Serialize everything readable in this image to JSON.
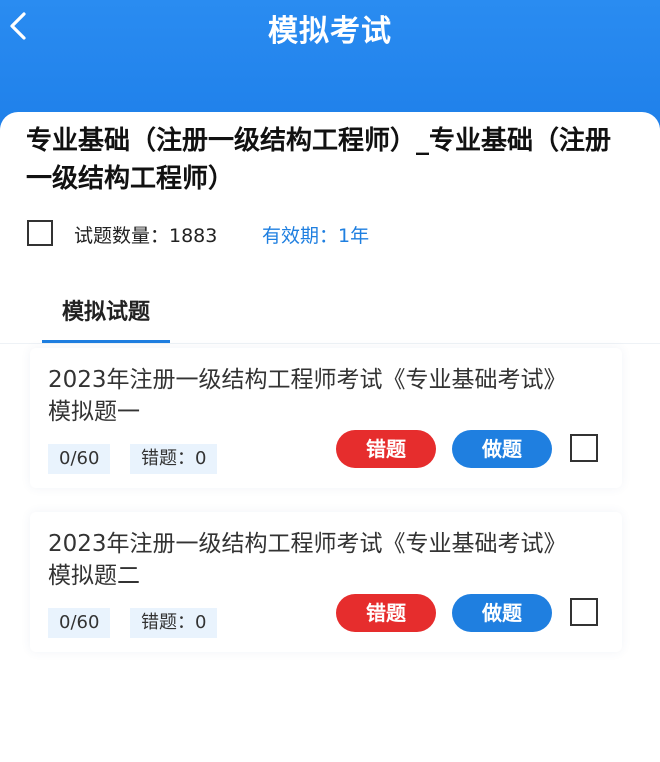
{
  "header": {
    "title": "模拟考试",
    "back_icon": "chevron-left-icon"
  },
  "course": {
    "title": "专业基础（注册一级结构工程师）_专业基础（注册一级结构工程师）",
    "count_label": "试题数量：1883",
    "validity_label": "有效期：1年"
  },
  "tabs": [
    {
      "label": "模拟试题",
      "active": true
    }
  ],
  "exams": [
    {
      "title": "2023年注册一级结构工程师考试《专业基础考试》模拟题一",
      "progress": "0/60",
      "wrong": "错题：0",
      "wrong_button": "错题",
      "do_button": "做题"
    },
    {
      "title": "2023年注册一级结构工程师考试《专业基础考试》模拟题二",
      "progress": "0/60",
      "wrong": "错题：0",
      "wrong_button": "错题",
      "do_button": "做题"
    }
  ],
  "colors": {
    "header_blue": "#2a8cf1",
    "accent_blue": "#1f7fe0",
    "accent_red": "#e62d2d",
    "chip_bg": "#e9f3fd"
  }
}
